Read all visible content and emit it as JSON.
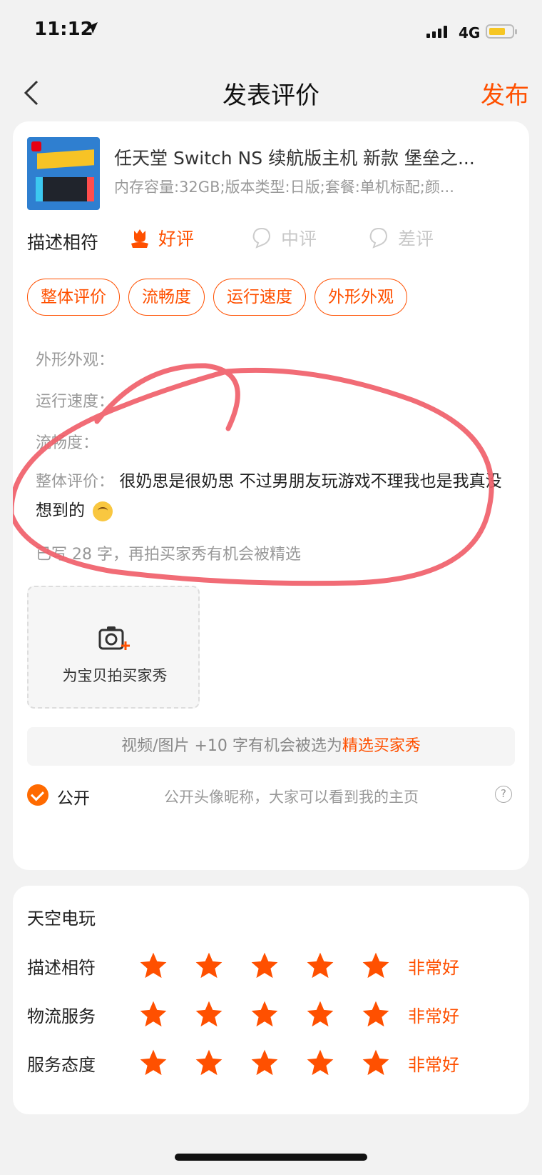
{
  "status_bar": {
    "time": "11:12",
    "network": "4G",
    "battery_level": 0.6
  },
  "nav": {
    "title": "发表评价",
    "publish_label": "发布"
  },
  "product": {
    "title": "任天堂 Switch NS 续航版主机 新款 堡垒之...",
    "spec": "内存容量:32GB;版本类型:日版;套餐:单机标配;颜..."
  },
  "rating": {
    "label": "描述相符",
    "options": [
      "好评",
      "中评",
      "差评"
    ],
    "selected": "好评"
  },
  "tags": [
    "整体评价",
    "流畅度",
    "运行速度",
    "外形外观"
  ],
  "review": {
    "lines": [
      "外形外观：",
      "运行速度：",
      "流畅度："
    ],
    "overall_label": "整体评价：",
    "overall_text": "很奶思是很奶思 不过男朋友玩游戏不理我也是我真没想到的",
    "word_count_text": "已写 28 字，再拍买家秀有机会被精选"
  },
  "upload": {
    "label": "为宝贝拍买家秀"
  },
  "tip": {
    "text": "视频/图片 +10 字有机会被选为",
    "highlight": "精选买家秀"
  },
  "public": {
    "label": "公开",
    "desc": "公开头像昵称，大家可以看到我的主页",
    "checked": true
  },
  "shop": {
    "name": "天空电玩",
    "scores": [
      {
        "label": "描述相符",
        "stars": 5,
        "text": "非常好"
      },
      {
        "label": "物流服务",
        "stars": 5,
        "text": "非常好"
      },
      {
        "label": "服务态度",
        "stars": 5,
        "text": "非常好"
      }
    ]
  },
  "colors": {
    "accent": "#ff5000",
    "annotation": "#f0606a"
  }
}
